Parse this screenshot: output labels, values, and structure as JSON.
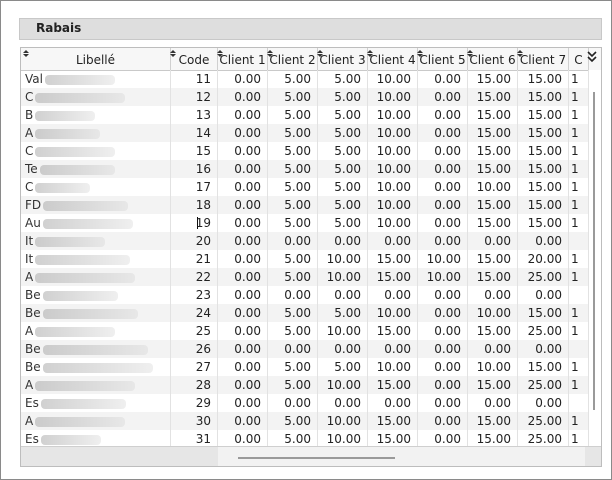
{
  "panel": {
    "title": "Rabais"
  },
  "columns": [
    "Libellé",
    "Code",
    "Client 1",
    "Client 2",
    "Client 3",
    "Client 4",
    "Client 5",
    "Client 6",
    "Client 7",
    "C"
  ],
  "rows": [
    {
      "lib": "Val",
      "code": "11",
      "vals": [
        "0.00",
        "5.00",
        "5.00",
        "10.00",
        "0.00",
        "15.00",
        "15.00",
        "1"
      ]
    },
    {
      "lib": "C",
      "code": "12",
      "vals": [
        "0.00",
        "5.00",
        "5.00",
        "10.00",
        "0.00",
        "15.00",
        "15.00",
        "1"
      ]
    },
    {
      "lib": "B",
      "code": "13",
      "vals": [
        "0.00",
        "5.00",
        "5.00",
        "10.00",
        "0.00",
        "15.00",
        "15.00",
        "1"
      ]
    },
    {
      "lib": "A",
      "code": "14",
      "vals": [
        "0.00",
        "5.00",
        "5.00",
        "10.00",
        "0.00",
        "15.00",
        "15.00",
        "1"
      ]
    },
    {
      "lib": "C",
      "code": "15",
      "vals": [
        "0.00",
        "5.00",
        "5.00",
        "10.00",
        "0.00",
        "15.00",
        "15.00",
        "1"
      ]
    },
    {
      "lib": "Te",
      "code": "16",
      "vals": [
        "0.00",
        "5.00",
        "5.00",
        "10.00",
        "0.00",
        "15.00",
        "15.00",
        "1"
      ]
    },
    {
      "lib": "C",
      "code": "17",
      "vals": [
        "0.00",
        "5.00",
        "5.00",
        "10.00",
        "0.00",
        "10.00",
        "15.00",
        "1"
      ]
    },
    {
      "lib": "FD",
      "code": "18",
      "vals": [
        "0.00",
        "5.00",
        "5.00",
        "10.00",
        "0.00",
        "15.00",
        "15.00",
        "1"
      ]
    },
    {
      "lib": "Au",
      "code": "19",
      "vals": [
        "0.00",
        "5.00",
        "5.00",
        "10.00",
        "0.00",
        "15.00",
        "15.00",
        "1"
      ]
    },
    {
      "lib": "It",
      "code": "20",
      "vals": [
        "0.00",
        "0.00",
        "0.00",
        "0.00",
        "0.00",
        "0.00",
        "0.00",
        ""
      ]
    },
    {
      "lib": "It",
      "code": "21",
      "vals": [
        "0.00",
        "5.00",
        "10.00",
        "15.00",
        "10.00",
        "15.00",
        "20.00",
        "1"
      ]
    },
    {
      "lib": "A",
      "code": "22",
      "vals": [
        "0.00",
        "5.00",
        "10.00",
        "15.00",
        "10.00",
        "15.00",
        "25.00",
        "1"
      ]
    },
    {
      "lib": "Be",
      "code": "23",
      "vals": [
        "0.00",
        "0.00",
        "0.00",
        "0.00",
        "0.00",
        "0.00",
        "0.00",
        ""
      ]
    },
    {
      "lib": "Be",
      "code": "24",
      "vals": [
        "0.00",
        "5.00",
        "5.00",
        "10.00",
        "0.00",
        "10.00",
        "15.00",
        "1"
      ]
    },
    {
      "lib": "A",
      "code": "25",
      "vals": [
        "0.00",
        "5.00",
        "10.00",
        "15.00",
        "0.00",
        "15.00",
        "25.00",
        "1"
      ]
    },
    {
      "lib": "Be",
      "code": "26",
      "vals": [
        "0.00",
        "0.00",
        "0.00",
        "0.00",
        "0.00",
        "0.00",
        "0.00",
        ""
      ]
    },
    {
      "lib": "Be",
      "code": "27",
      "vals": [
        "0.00",
        "5.00",
        "5.00",
        "10.00",
        "0.00",
        "10.00",
        "15.00",
        "1"
      ]
    },
    {
      "lib": "A",
      "code": "28",
      "vals": [
        "0.00",
        "5.00",
        "10.00",
        "15.00",
        "0.00",
        "15.00",
        "25.00",
        "1"
      ]
    },
    {
      "lib": "Es",
      "code": "29",
      "vals": [
        "0.00",
        "0.00",
        "0.00",
        "0.00",
        "0.00",
        "0.00",
        "0.00",
        ""
      ]
    },
    {
      "lib": "A",
      "code": "30",
      "vals": [
        "0.00",
        "5.00",
        "10.00",
        "15.00",
        "0.00",
        "15.00",
        "25.00",
        "1"
      ]
    },
    {
      "lib": "Es",
      "code": "31",
      "vals": [
        "0.00",
        "5.00",
        "10.00",
        "15.00",
        "0.00",
        "15.00",
        "25.00",
        "1"
      ]
    }
  ]
}
